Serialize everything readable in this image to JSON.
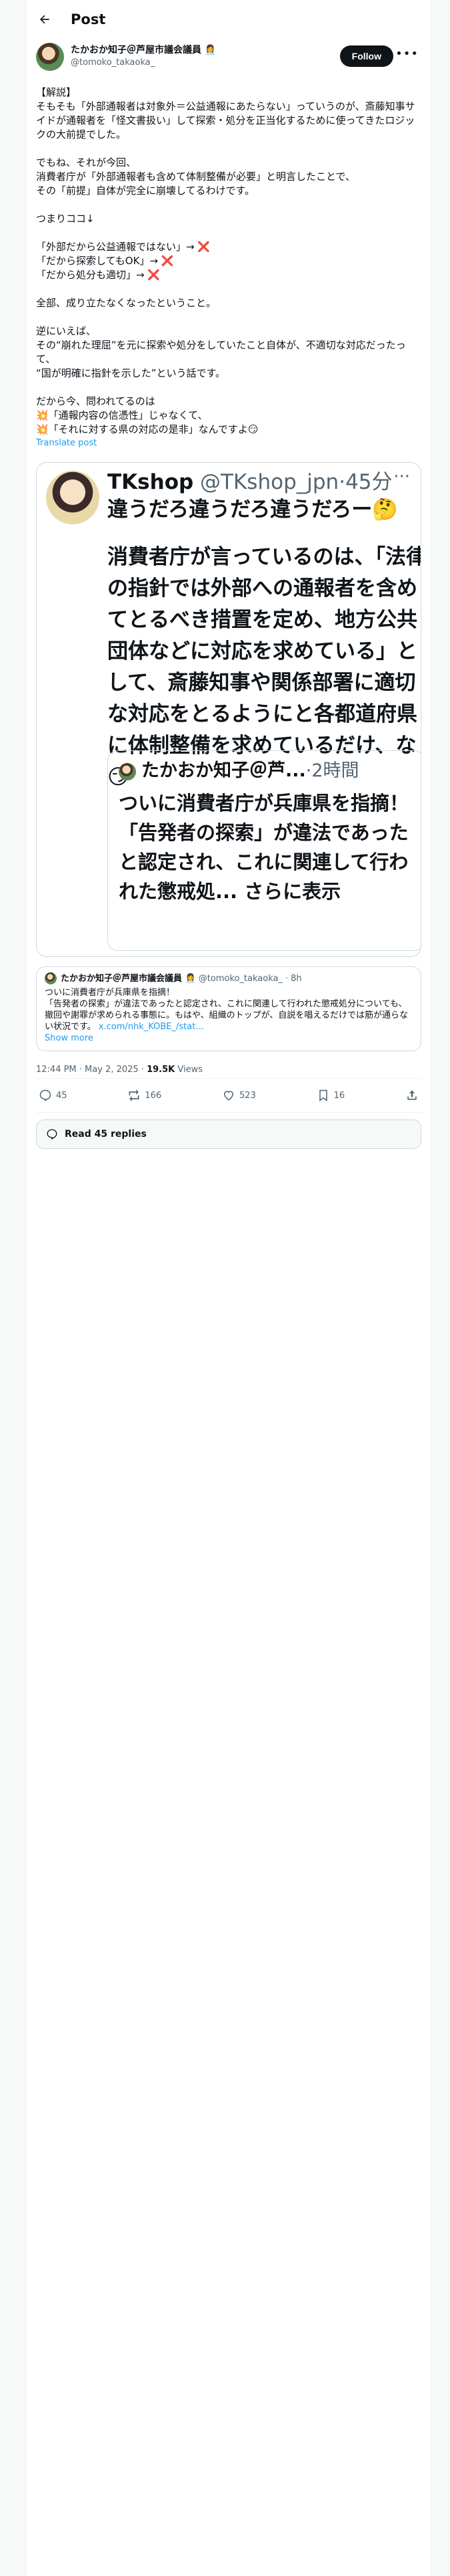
{
  "header": {
    "title": "Post"
  },
  "author": {
    "name": "たかおか知子＠芦屋市議会議員 👩‍💼",
    "handle": "@tomoko_takaoka_",
    "follow_label": "Follow"
  },
  "post": {
    "body": "【解説】\nそもそも「外部通報者は対象外＝公益通報にあたらない」っていうのが、斎藤知事サイドが通報者を「怪文書扱い」して探索・処分を正当化するために使ってきたロジックの大前提でした。\n\nでもね、それが今回、\n消費者庁が「外部通報者も含めて体制整備が必要」と明言したことで、\nその「前提」自体が完全に崩壊してるわけです。\n\nつまりココ↓\n\n「外部だから公益通報ではない」→ ❌\n「だから探索してもOK」→ ❌\n「だから処分も適切」→ ❌\n\n全部、成り立たなくなったということ。\n\n逆にいえば、\nその“崩れた理屈”を元に探索や処分をしていたこと自体が、不適切な対応だったって、\n“国が明確に指針を示した”という話です。\n\nだから今、問われてるのは\n💥「通報内容の信憑性」じゃなくて、\n💥「それに対する県の対応の是非」なんですよ😏",
    "translate_label": "Translate post"
  },
  "quote": {
    "name": "TKshop",
    "handle": "@TKshop_jpn",
    "time": "45分",
    "headline": "違うだろ違うだろ違うだろー🤔",
    "text": "消費者庁が言っているのは、「法律の指針では外部への通報者を含めてとるべき措置を定め、地方公共団体などに対応を求めている」として、斎藤知事や関係部署に適切な対応をとるようにと各都道府県に体制整備を求めているだけ、な😏",
    "inner": {
      "name": "たかおか知子＠芦...",
      "time": "2時間",
      "text": "ついに消費者庁が兵庫県を指摘！\n「告発者の探索」が違法であったと認定され、これに関連して行われた懲戒処... さらに表示"
    }
  },
  "quote2": {
    "name": "たかおか知子＠芦屋市議会議員 👩‍💼",
    "handle": "@tomoko_takaoka_",
    "time": "8h",
    "body": "ついに消費者庁が兵庫県を指摘！\n「告発者の探索」が違法であったと認定され、これに関連して行われた懲戒処分についても、撤回や謝罪が求められる事態に。もはや、組織のトップが、自説を唱えるだけでは筋が通らない状況です。",
    "link": "x.com/nhk_KOBE_/stat…",
    "show_more": "Show more"
  },
  "meta": {
    "time": "12:44 PM · May 2, 2025 · ",
    "views_count": "19.5K",
    "views_label": " Views"
  },
  "actions": {
    "replies": "45",
    "reposts": "166",
    "likes": "523",
    "bookmarks": "16"
  },
  "read_replies_label": "Read 45 replies"
}
